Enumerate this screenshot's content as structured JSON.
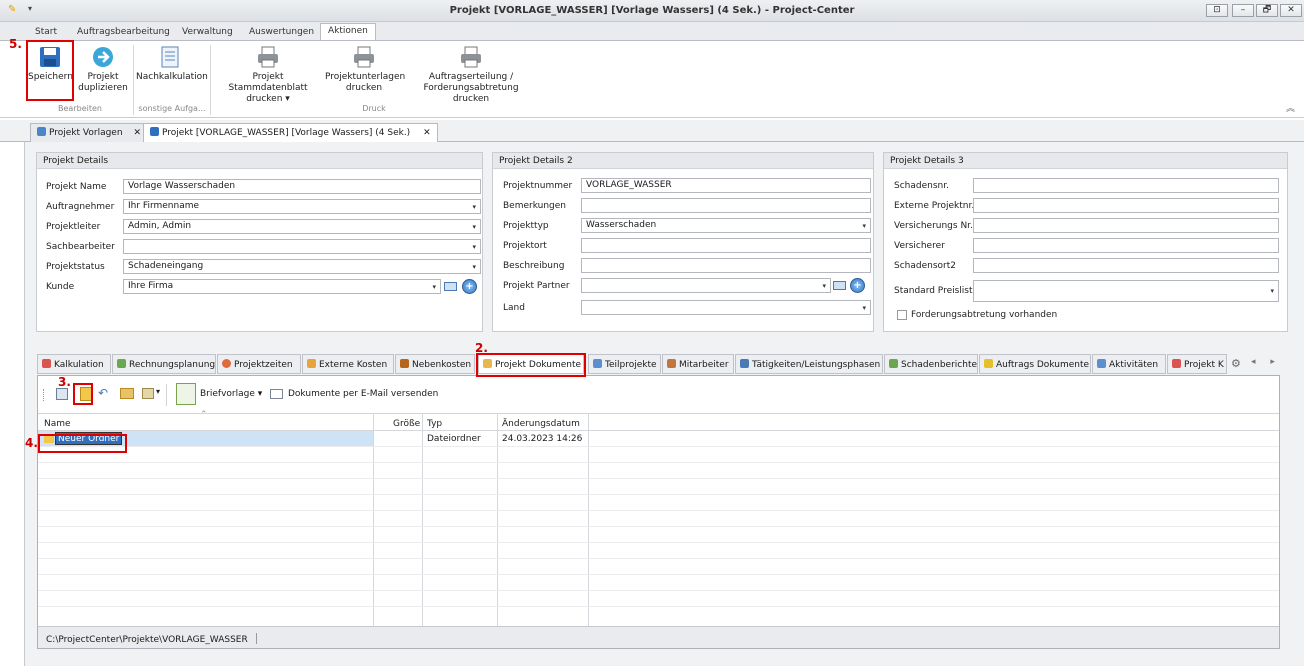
{
  "window": {
    "title_left": "Projekt [VORLAGE_WASSER] [Vorlage Wassers] (4 Sek.) - ",
    "title_right": "Project-Center",
    "btn_restore": "⊡",
    "btn_min": "–",
    "btn_max": "🗗",
    "btn_close": "✕"
  },
  "ribbon_tabs": [
    "Start",
    "Auftragsbearbeitung",
    "Verwaltung",
    "Auswertungen",
    "Aktionen"
  ],
  "ribbon": {
    "save": "Speichern",
    "duplicate_l1": "Projekt",
    "duplicate_l2": "duplizieren",
    "nachkalk": "Nachkalkulation",
    "stamm_l1": "Projekt Stammdatenblatt",
    "stamm_l2": "drucken ▾",
    "unterlagen_l1": "Projektunterlagen",
    "unterlagen_l2": "drucken",
    "auftrag_l1": "Auftragserteilung /",
    "auftrag_l2": "Forderungsabtretung drucken",
    "group_bearbeiten": "Bearbeiten",
    "group_sonstige": "sonstige Aufga...",
    "group_druck": "Druck"
  },
  "doc_tabs": [
    {
      "label": "Projekt Vorlagen"
    },
    {
      "label": "Projekt [VORLAGE_WASSER] [Vorlage Wassers] (4 Sek.)"
    }
  ],
  "close_x": "✕",
  "details1": {
    "header": "Projekt Details",
    "rows": [
      {
        "label": "Projekt Name",
        "value": ""
      },
      {
        "label": "Auftragnehmer",
        "value": ""
      },
      {
        "label": "Projektleiter",
        "value": ""
      },
      {
        "label": "Sachbearbeiter",
        "value": ""
      },
      {
        "label": "Projektstatus",
        "value": ""
      },
      {
        "label": "Kunde",
        "value": ""
      }
    ],
    "values": [
      "Vorlage Wasserschaden",
      "Ihr Firmenname",
      "Admin, Admin",
      "",
      "Schadeneingang",
      "Ihre Firma"
    ]
  },
  "details2": {
    "header": "Projekt Details 2",
    "labels": [
      "Projektnummer",
      "Bemerkungen",
      "Projekttyp",
      "Projektort",
      "Beschreibung",
      "Projekt Partner",
      "Land"
    ],
    "values": [
      "VORLAGE_WASSER",
      "",
      "Wasserschaden",
      "",
      "",
      "",
      ""
    ]
  },
  "details3": {
    "header": "Projekt Details 3",
    "labels": [
      "Schadensnr.",
      "Externe Projektnr.",
      "Versicherungs Nr.",
      "Versicherer",
      "Schadensort2",
      "Standard Preisliste"
    ],
    "checkbox": "Forderungsabtretung vorhanden"
  },
  "caret": "▾",
  "plus": "+",
  "bottom_tabs": [
    "Kalkulation",
    "Rechnungsplanung",
    "Projektzeiten",
    "Externe Kosten",
    "Nebenkosten",
    "Projekt Dokumente",
    "Teilprojekte",
    "Mitarbeiter",
    "Tätigkeiten/Leistungsphasen",
    "Schadenberichte",
    "Auftrags Dokumente",
    "Aktivitäten",
    "Projekt K"
  ],
  "tab_arrows": "◂ ▸",
  "toolbar": {
    "briefvorlage": "Briefvorlage ▾",
    "email": "Dokumente per E-Mail versenden"
  },
  "grid": {
    "columns": [
      "Name",
      "Größe",
      "Typ",
      "Änderungsdatum"
    ],
    "sort_indicator": "⌃",
    "row": {
      "name": "Neuer Ordner",
      "size": "",
      "type": "Dateiordner",
      "date": "24.03.2023 14:26"
    }
  },
  "status_path": "C:\\ProjectCenter\\Projekte\\VORLAGE_WASSER",
  "annotations": [
    "5.",
    "2.",
    "3.",
    "4."
  ],
  "colors": {
    "highlight_red": "#e00000",
    "accent_blue": "#2f78c8"
  }
}
